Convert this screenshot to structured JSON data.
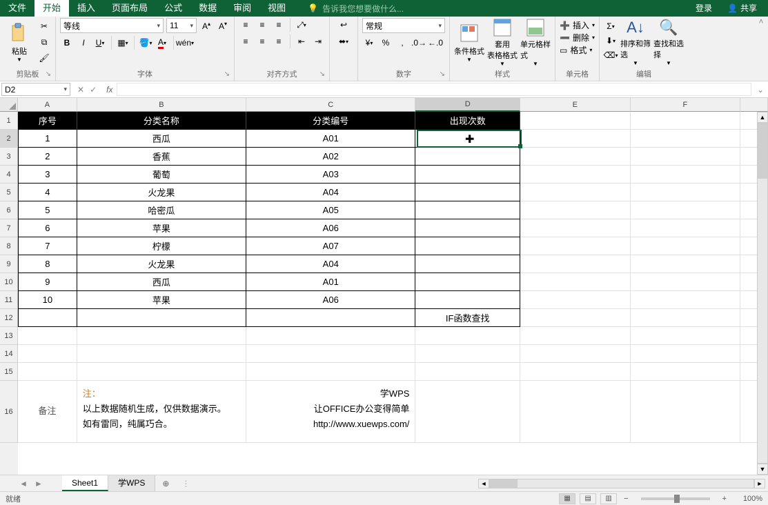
{
  "titlebar": {
    "tabs": [
      "文件",
      "开始",
      "插入",
      "页面布局",
      "公式",
      "数据",
      "审阅",
      "视图"
    ],
    "active_tab_index": 1,
    "tell_me": "告诉我您想要做什么...",
    "login": "登录",
    "share": "共享"
  },
  "ribbon": {
    "clipboard": {
      "paste": "粘贴",
      "label": "剪贴板"
    },
    "font": {
      "name": "等线",
      "size": "11",
      "wen": "wén",
      "label": "字体"
    },
    "align": {
      "label": "对齐方式"
    },
    "number": {
      "format": "常规",
      "label": "数字"
    },
    "styles": {
      "cond": "条件格式",
      "table": "套用\n表格格式",
      "cell": "单元格样式",
      "label": "样式"
    },
    "cells": {
      "insert": "插入",
      "delete": "删除",
      "format": "格式",
      "label": "单元格"
    },
    "editing": {
      "sort": "排序和筛选",
      "find": "查找和选择",
      "label": "编辑"
    }
  },
  "namebar": {
    "ref": "D2",
    "formula": ""
  },
  "columns": [
    "A",
    "B",
    "C",
    "D",
    "E",
    "F"
  ],
  "headers": {
    "A": "序号",
    "B": "分类名称",
    "C": "分类编号",
    "D": "出现次数"
  },
  "rows": [
    {
      "n": "1",
      "name": "西瓜",
      "code": "A01",
      "cnt": ""
    },
    {
      "n": "2",
      "name": "香蕉",
      "code": "A02",
      "cnt": ""
    },
    {
      "n": "3",
      "name": "葡萄",
      "code": "A03",
      "cnt": ""
    },
    {
      "n": "4",
      "name": "火龙果",
      "code": "A04",
      "cnt": ""
    },
    {
      "n": "5",
      "name": "哈密瓜",
      "code": "A05",
      "cnt": ""
    },
    {
      "n": "6",
      "name": "苹果",
      "code": "A06",
      "cnt": ""
    },
    {
      "n": "7",
      "name": "柠檬",
      "code": "A07",
      "cnt": ""
    },
    {
      "n": "8",
      "name": "火龙果",
      "code": "A04",
      "cnt": ""
    },
    {
      "n": "9",
      "name": "西瓜",
      "code": "A01",
      "cnt": ""
    },
    {
      "n": "10",
      "name": "苹果",
      "code": "A06",
      "cnt": ""
    }
  ],
  "extra_d12": "IF函数查找",
  "notes": {
    "label": "备注",
    "title": "注：",
    "line1": "以上数据随机生成，仅供数据演示。",
    "line2": "如有雷同，纯属巧合。",
    "r1": "学WPS",
    "r2": "让OFFICE办公变得简单",
    "r3": "http://www.xuewps.com/"
  },
  "sheets": {
    "tabs": [
      "Sheet1",
      "学WPS"
    ],
    "active": 0
  },
  "status": {
    "ready": "就绪",
    "zoom": "100%"
  }
}
